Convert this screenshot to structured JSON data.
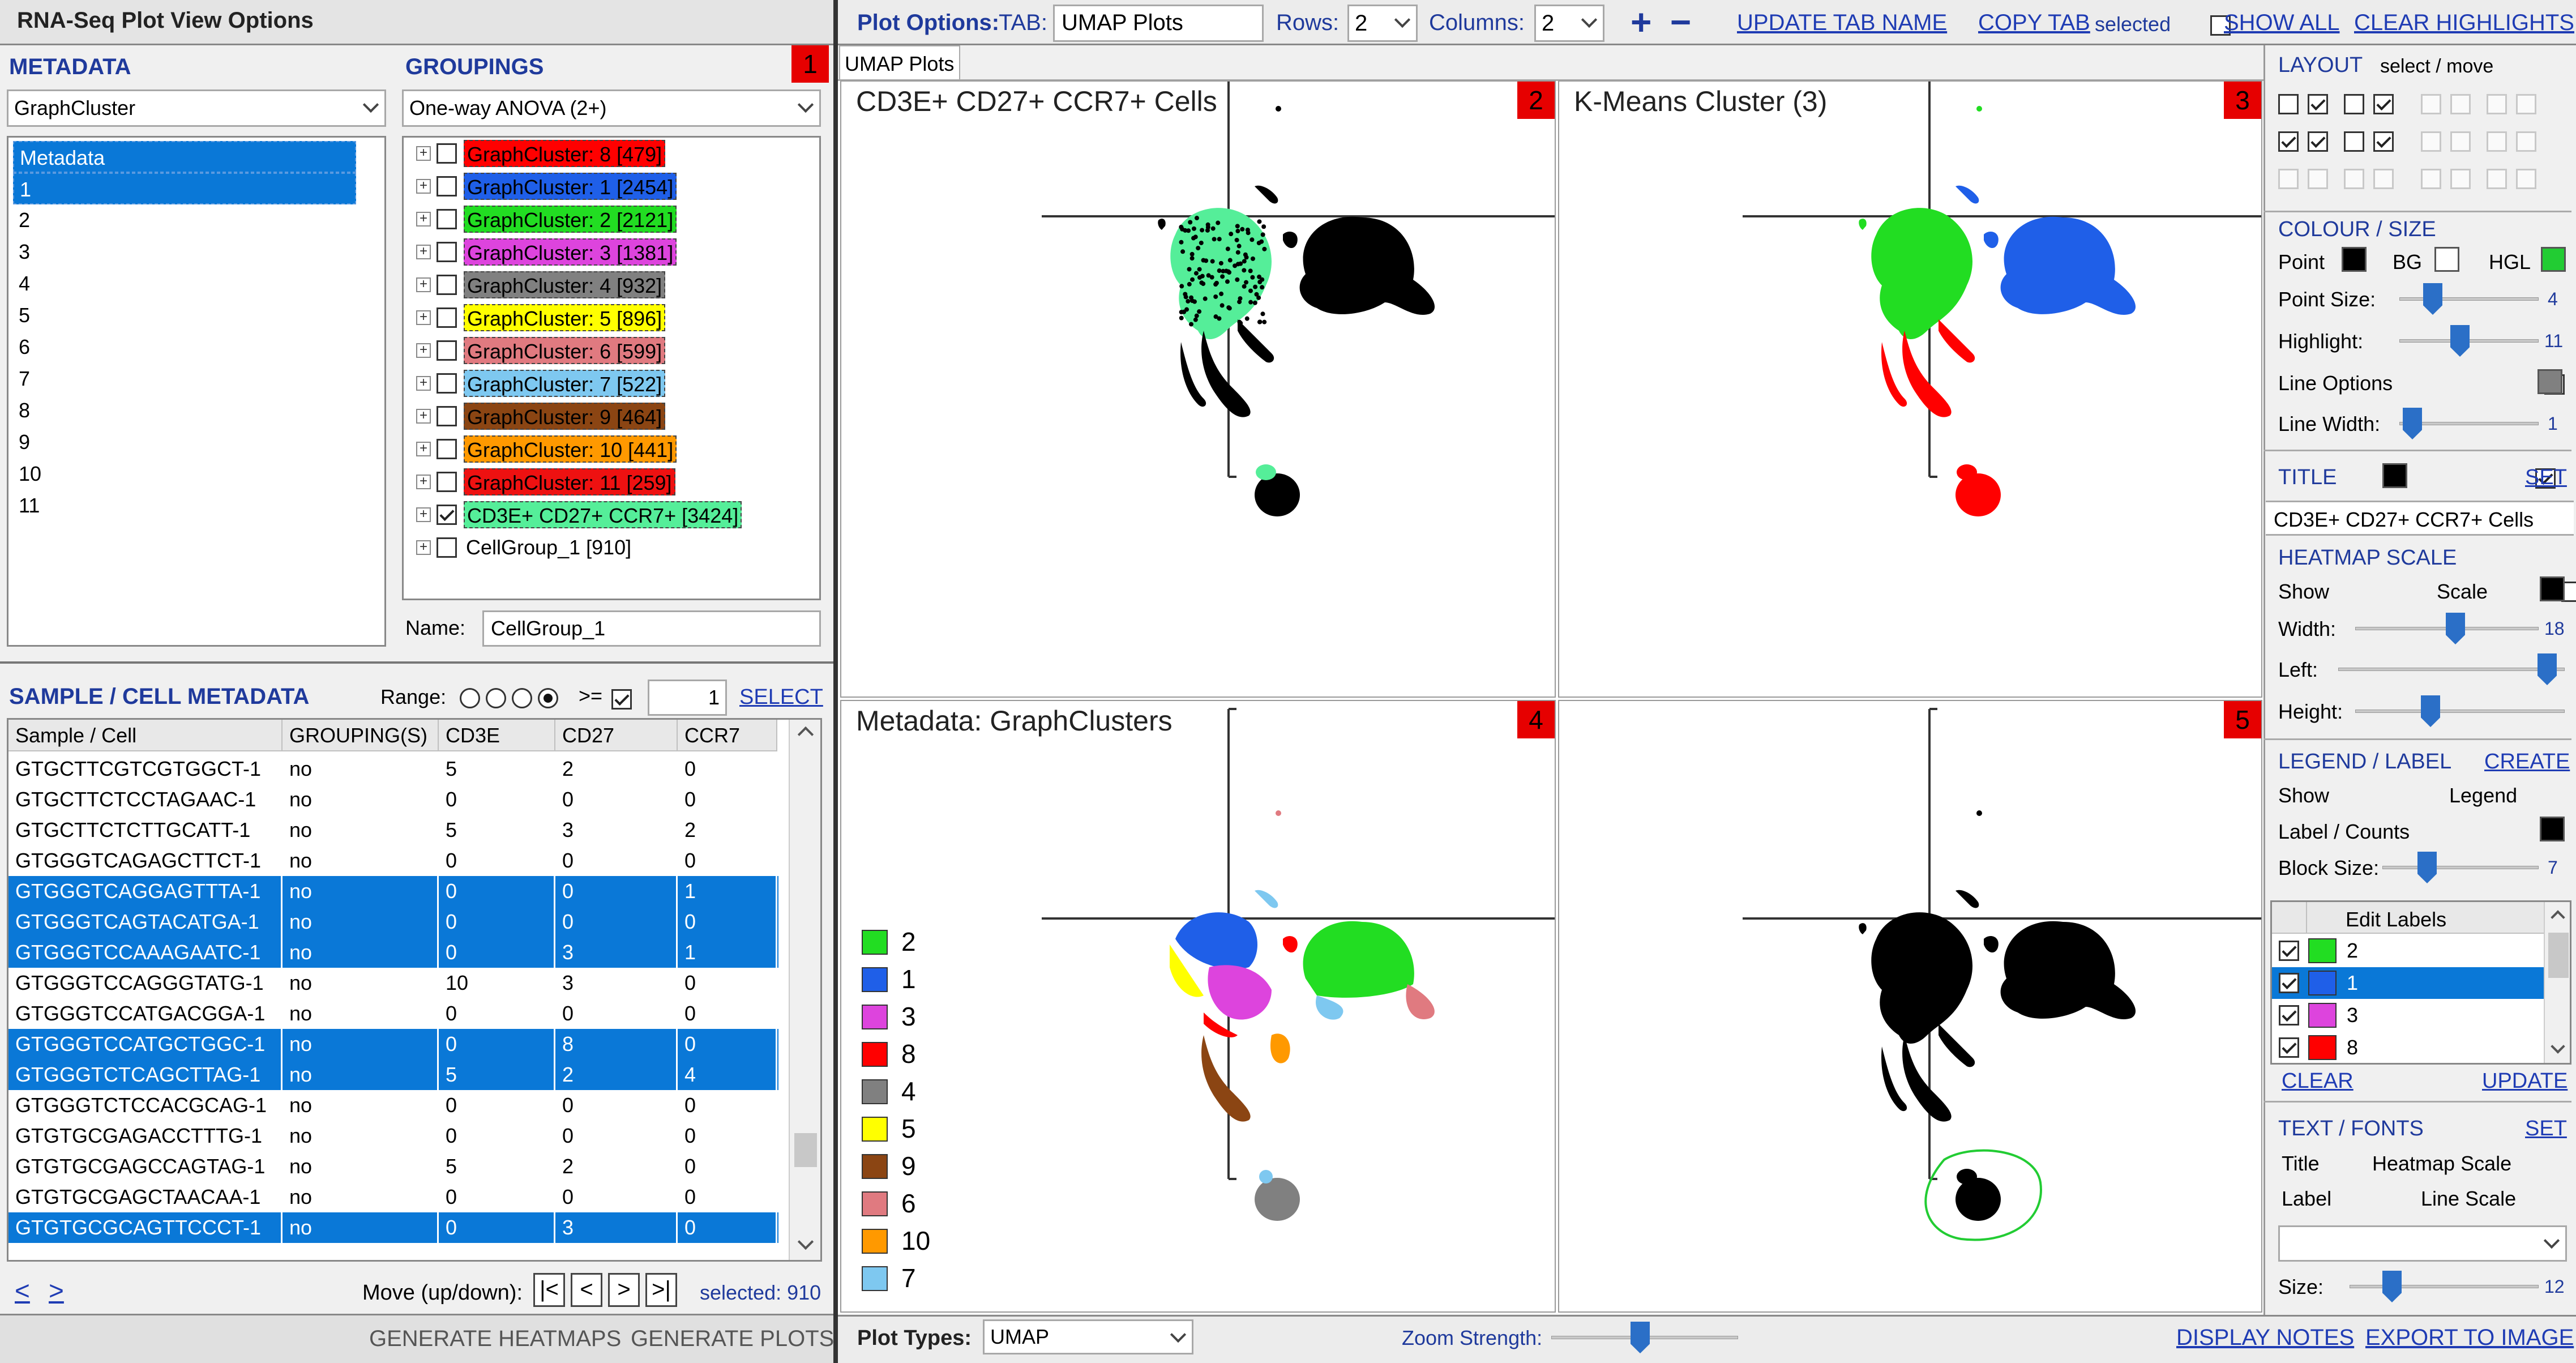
{
  "left": {
    "title": "RNA-Seq Plot View Options",
    "badge": "1",
    "metadata": {
      "header": "METADATA",
      "dropdown": "GraphCluster",
      "list": [
        "Metadata",
        "1",
        "2",
        "3",
        "4",
        "5",
        "6",
        "7",
        "8",
        "9",
        "10",
        "11"
      ],
      "selected": [
        0,
        1
      ]
    },
    "groupings": {
      "header": "GROUPINGS",
      "dropdown": "One-way ANOVA (2+)",
      "items": [
        {
          "label": "GraphCluster: 8 [479]",
          "color": "#ff0000",
          "checked": false
        },
        {
          "label": "GraphCluster: 1 [2454]",
          "color": "#1f5fe8",
          "checked": false
        },
        {
          "label": "GraphCluster: 2 [2121]",
          "color": "#22dd22",
          "checked": false
        },
        {
          "label": "GraphCluster: 3 [1381]",
          "color": "#dd44dd",
          "checked": false
        },
        {
          "label": "GraphCluster: 4 [932]",
          "color": "#808080",
          "checked": false
        },
        {
          "label": "GraphCluster: 5 [896]",
          "color": "#ffff00",
          "checked": false
        },
        {
          "label": "GraphCluster: 6 [599]",
          "color": "#e07a80",
          "checked": false
        },
        {
          "label": "GraphCluster: 7 [522]",
          "color": "#7ec8f0",
          "checked": false
        },
        {
          "label": "GraphCluster: 9 [464]",
          "color": "#8b4513",
          "checked": false
        },
        {
          "label": "GraphCluster: 10 [441]",
          "color": "#ff9900",
          "checked": false
        },
        {
          "label": "GraphCluster: 11 [259]",
          "color": "#ee1111",
          "checked": false
        },
        {
          "label": "CD3E+ CD27+ CCR7+ [3424]",
          "color": "#55ee99",
          "checked": true
        },
        {
          "label": "CellGroup_1 [910]",
          "color": "",
          "checked": false
        }
      ],
      "name_label": "Name:",
      "name_value": "CellGroup_1"
    },
    "sample": {
      "header": "SAMPLE / CELL METADATA",
      "range_label": "Range:",
      "range_op": ">=",
      "range_value": "1",
      "select_link": "SELECT",
      "columns": [
        "Sample / Cell",
        "GROUPING(S)",
        "CD3E",
        "CD27",
        "CCR7"
      ],
      "rows": [
        {
          "cells": [
            "GTGCTTCGTCGTGGCT-1",
            "no",
            "5",
            "2",
            "0"
          ],
          "sel": false
        },
        {
          "cells": [
            "GTGCTTCTCCTAGAAC-1",
            "no",
            "0",
            "0",
            "0"
          ],
          "sel": false
        },
        {
          "cells": [
            "GTGCTTCTCTTGCATT-1",
            "no",
            "5",
            "3",
            "2"
          ],
          "sel": false
        },
        {
          "cells": [
            "GTGGGTCAGAGCTTCT-1",
            "no",
            "0",
            "0",
            "0"
          ],
          "sel": false
        },
        {
          "cells": [
            "GTGGGTCAGGAGTTTA-1",
            "no",
            "0",
            "0",
            "1"
          ],
          "sel": true
        },
        {
          "cells": [
            "GTGGGTCAGTACATGA-1",
            "no",
            "0",
            "0",
            "0"
          ],
          "sel": true
        },
        {
          "cells": [
            "GTGGGTCCAAAGAATC-1",
            "no",
            "0",
            "3",
            "1"
          ],
          "sel": true
        },
        {
          "cells": [
            "GTGGGTCCAGGGTATG-1",
            "no",
            "10",
            "3",
            "0"
          ],
          "sel": false
        },
        {
          "cells": [
            "GTGGGTCCATGACGGA-1",
            "no",
            "0",
            "0",
            "0"
          ],
          "sel": false
        },
        {
          "cells": [
            "GTGGGTCCATGCTGGC-1",
            "no",
            "0",
            "8",
            "0"
          ],
          "sel": true
        },
        {
          "cells": [
            "GTGGGTCTCAGCTTAG-1",
            "no",
            "5",
            "2",
            "4"
          ],
          "sel": true
        },
        {
          "cells": [
            "GTGGGTCTCCACGCAG-1",
            "no",
            "0",
            "0",
            "0"
          ],
          "sel": false
        },
        {
          "cells": [
            "GTGTGCGAGACCTTTG-1",
            "no",
            "0",
            "0",
            "0"
          ],
          "sel": false
        },
        {
          "cells": [
            "GTGTGCGAGCCAGTAG-1",
            "no",
            "5",
            "2",
            "0"
          ],
          "sel": false
        },
        {
          "cells": [
            "GTGTGCGAGCTAACAA-1",
            "no",
            "0",
            "0",
            "0"
          ],
          "sel": false
        },
        {
          "cells": [
            "GTGTGCGCAGTTCCCT-1",
            "no",
            "0",
            "3",
            "0"
          ],
          "sel": true
        }
      ],
      "prev": "<",
      "next": ">",
      "move_label": "Move (up/down):",
      "selected_text": "selected: 910"
    },
    "footer": {
      "heatmaps": "GENERATE HEATMAPS",
      "plots": "GENERATE PLOTS"
    }
  },
  "top": {
    "plot_options": "Plot Options:",
    "tab_label": "TAB:",
    "tab_value": "UMAP Plots",
    "rows_label": "Rows:",
    "rows_value": "2",
    "cols_label": "Columns:",
    "cols_value": "2",
    "plus": "+",
    "minus": "−",
    "update_tab": "UPDATE TAB NAME",
    "copy_tab": "COPY TAB",
    "selected_label": "selected",
    "show_all": "SHOW ALL",
    "clear_highlights": "CLEAR HIGHLIGHTS"
  },
  "tab": "UMAP Plots",
  "plots": [
    {
      "title": "CD3E+ CD27+ CCR7+ Cells",
      "badge": "2"
    },
    {
      "title": "K-Means Cluster (3)",
      "badge": "3"
    },
    {
      "title": "Metadata: GraphClusters",
      "badge": "4"
    },
    {
      "title": "",
      "badge": "5"
    }
  ],
  "legend": [
    {
      "label": "2",
      "color": "#22dd22"
    },
    {
      "label": "1",
      "color": "#1f5fe8"
    },
    {
      "label": "3",
      "color": "#dd44dd"
    },
    {
      "label": "8",
      "color": "#ff0000"
    },
    {
      "label": "4",
      "color": "#808080"
    },
    {
      "label": "5",
      "color": "#ffff00"
    },
    {
      "label": "9",
      "color": "#8b4513"
    },
    {
      "label": "6",
      "color": "#e07a80"
    },
    {
      "label": "10",
      "color": "#ff9900"
    },
    {
      "label": "7",
      "color": "#7ec8f0"
    }
  ],
  "right": {
    "layout": {
      "header": "LAYOUT",
      "select_move": "select / move"
    },
    "colour": {
      "header": "COLOUR / SIZE",
      "point": "Point",
      "bg": "BG",
      "hgl": "HGL",
      "point_size": "Point Size:",
      "point_size_val": "4",
      "highlight": "Highlight:",
      "highlight_val": "11",
      "line_options": "Line Options",
      "line_width": "Line Width:",
      "line_width_val": "1"
    },
    "title": {
      "header": "TITLE",
      "set": "SET",
      "value": "CD3E+ CD27+ CCR7+ Cells"
    },
    "heatmap": {
      "header": "HEATMAP SCALE",
      "show": "Show",
      "scale": "Scale",
      "width": "Width:",
      "width_val": "18",
      "left": "Left:",
      "height": "Height:"
    },
    "legend": {
      "header": "LEGEND / LABEL",
      "create": "CREATE",
      "show": "Show",
      "legend": "Legend",
      "label_counts": "Label / Counts",
      "block_size": "Block Size:",
      "block_val": "7"
    },
    "edit_labels": {
      "header": "Edit Labels",
      "rows": [
        {
          "label": "2",
          "color": "#22dd22",
          "sel": false
        },
        {
          "label": "1",
          "color": "#1f5fe8",
          "sel": true
        },
        {
          "label": "3",
          "color": "#dd44dd",
          "sel": false
        },
        {
          "label": "8",
          "color": "#ff0000",
          "sel": false
        }
      ],
      "clear": "CLEAR",
      "update": "UPDATE"
    },
    "text_fonts": {
      "header": "TEXT / FONTS",
      "set": "SET",
      "title": "Title",
      "heatmap_scale": "Heatmap Scale",
      "label": "Label",
      "line_scale": "Line Scale",
      "size": "Size:",
      "size_val": "12"
    }
  },
  "bottom": {
    "plot_types": "Plot Types:",
    "plot_type_value": "UMAP",
    "zoom": "Zoom Strength:",
    "display_notes": "DISPLAY NOTES",
    "export": "EXPORT TO IMAGE"
  }
}
